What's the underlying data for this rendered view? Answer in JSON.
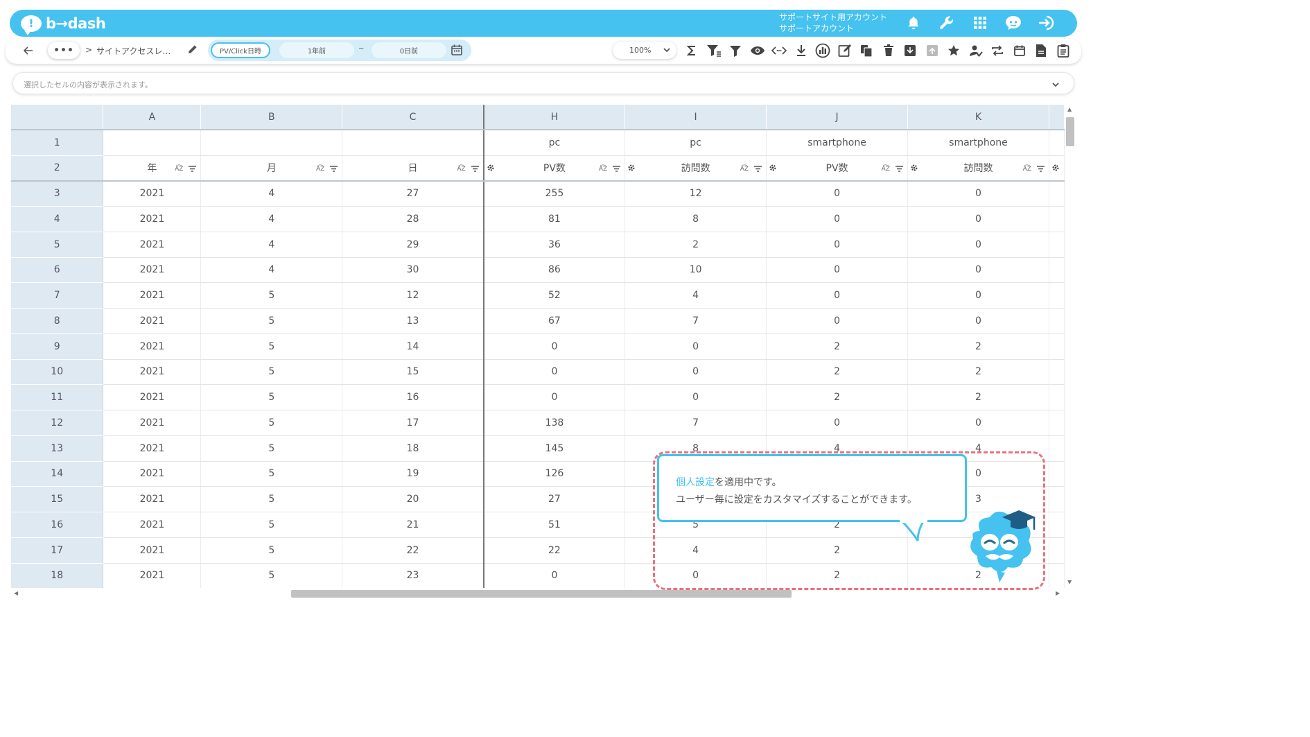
{
  "brand": {
    "name": "b→dash"
  },
  "header": {
    "account_line1": "サポートサイト用アカウント",
    "account_line2": "サポートアカウント"
  },
  "toolbar": {
    "breadcrumb_sep": ">",
    "title": "サイトアクセスレ…",
    "date_type": "PV/Click日時",
    "date_from": "1年前",
    "tilde": "~",
    "date_to": "0日前",
    "zoom": "100%"
  },
  "cellbar": {
    "placeholder": "選択したセルの内容が表示されます。"
  },
  "grid": {
    "columns": [
      "A",
      "B",
      "C",
      "H",
      "I",
      "J",
      "K"
    ],
    "header1": [
      "",
      "",
      "",
      "pc",
      "pc",
      "smartphone",
      "smartphone"
    ],
    "header2": [
      "年",
      "月",
      "日",
      "PV数",
      "訪問数",
      "PV数",
      "訪問数"
    ],
    "rows": [
      {
        "n": "1"
      },
      {
        "n": "2"
      },
      {
        "n": "3",
        "cells": [
          "2021",
          "4",
          "27",
          "255",
          "12",
          "0",
          "0"
        ]
      },
      {
        "n": "4",
        "cells": [
          "2021",
          "4",
          "28",
          "81",
          "8",
          "0",
          "0"
        ]
      },
      {
        "n": "5",
        "cells": [
          "2021",
          "4",
          "29",
          "36",
          "2",
          "0",
          "0"
        ]
      },
      {
        "n": "6",
        "cells": [
          "2021",
          "4",
          "30",
          "86",
          "10",
          "0",
          "0"
        ]
      },
      {
        "n": "7",
        "cells": [
          "2021",
          "5",
          "12",
          "52",
          "4",
          "0",
          "0"
        ]
      },
      {
        "n": "8",
        "cells": [
          "2021",
          "5",
          "13",
          "67",
          "7",
          "0",
          "0"
        ]
      },
      {
        "n": "9",
        "cells": [
          "2021",
          "5",
          "14",
          "0",
          "0",
          "2",
          "2"
        ]
      },
      {
        "n": "10",
        "cells": [
          "2021",
          "5",
          "15",
          "0",
          "0",
          "2",
          "2"
        ]
      },
      {
        "n": "11",
        "cells": [
          "2021",
          "5",
          "16",
          "0",
          "0",
          "2",
          "2"
        ]
      },
      {
        "n": "12",
        "cells": [
          "2021",
          "5",
          "17",
          "138",
          "7",
          "0",
          "0"
        ]
      },
      {
        "n": "13",
        "cells": [
          "2021",
          "5",
          "18",
          "145",
          "8",
          "4",
          "4"
        ]
      },
      {
        "n": "14",
        "cells": [
          "2021",
          "5",
          "19",
          "126",
          "",
          "",
          "0"
        ]
      },
      {
        "n": "15",
        "cells": [
          "2021",
          "5",
          "20",
          "27",
          "",
          "",
          "3"
        ]
      },
      {
        "n": "16",
        "cells": [
          "2021",
          "5",
          "21",
          "51",
          "5",
          "2",
          ""
        ]
      },
      {
        "n": "17",
        "cells": [
          "2021",
          "5",
          "22",
          "22",
          "4",
          "2",
          ""
        ]
      },
      {
        "n": "18",
        "cells": [
          "2021",
          "5",
          "23",
          "0",
          "0",
          "2",
          "2"
        ]
      }
    ]
  },
  "tooltip": {
    "link": "個人設定",
    "line1_rest": "を適用中です。",
    "line2": "ユーザー毎に設定をカスタマイズすることができます。"
  },
  "colors": {
    "accent": "#45c2ef",
    "header_bg": "#dfe9f2",
    "dash": "#e8727d"
  }
}
